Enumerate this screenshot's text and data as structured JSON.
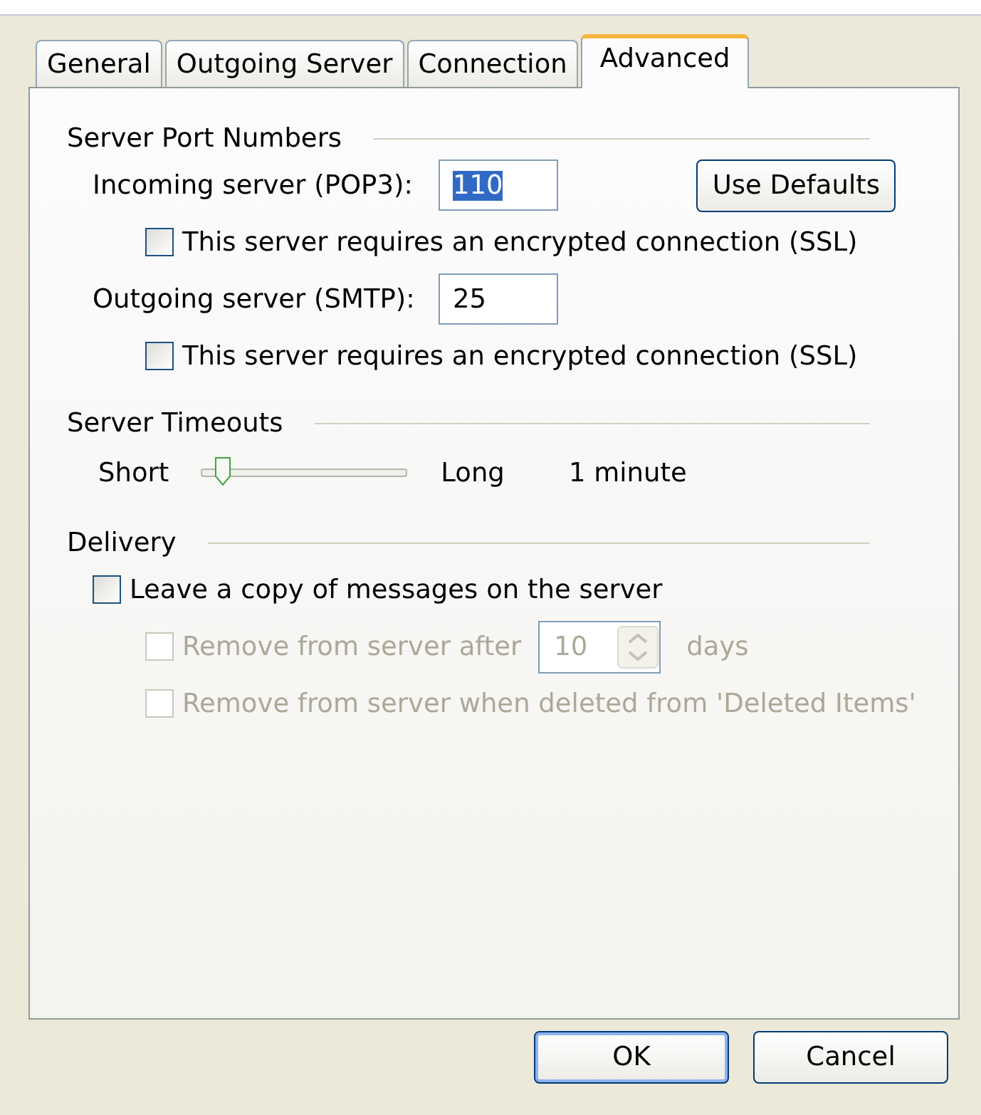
{
  "tabs": [
    {
      "label": "General",
      "selected": false
    },
    {
      "label": "Outgoing Server",
      "selected": false
    },
    {
      "label": "Connection",
      "selected": false
    },
    {
      "label": "Advanced",
      "selected": true
    }
  ],
  "sections": [
    {
      "title": "Server Port Numbers",
      "button": "Use Defaults",
      "rows": [
        {
          "kind": "field",
          "label": "Incoming server (POP3):",
          "value": "110",
          "text_selected": true,
          "children": [
            {
              "kind": "check",
              "label": "This server requires an encrypted connection (SSL)",
              "checked": false,
              "disabled": false
            }
          ]
        },
        {
          "kind": "field",
          "label": "Outgoing server (SMTP):",
          "value": "25",
          "text_selected": false,
          "children": [
            {
              "kind": "check",
              "label": "This server requires an encrypted connection (SSL)",
              "checked": false,
              "disabled": false
            }
          ]
        }
      ]
    },
    {
      "title": "Server Timeouts",
      "rows": [
        {
          "kind": "slider",
          "min_label": "Short",
          "max_label": "Long",
          "level": 0.1,
          "reading": "1 minute"
        }
      ]
    },
    {
      "title": "Delivery",
      "rows": [
        {
          "kind": "check",
          "label": "Leave a copy of messages on the server",
          "checked": false,
          "disabled": false,
          "children": [
            {
              "kind": "check_spin",
              "label": "Remove from server after",
              "checked": false,
              "disabled": true,
              "value": "10",
              "unit": "days"
            },
            {
              "kind": "check",
              "label": "Remove from server when deleted from 'Deleted Items'",
              "checked": false,
              "disabled": true
            }
          ]
        }
      ]
    }
  ],
  "buttons": [
    {
      "label": "OK",
      "default": true
    },
    {
      "label": "Cancel",
      "default": false
    }
  ]
}
